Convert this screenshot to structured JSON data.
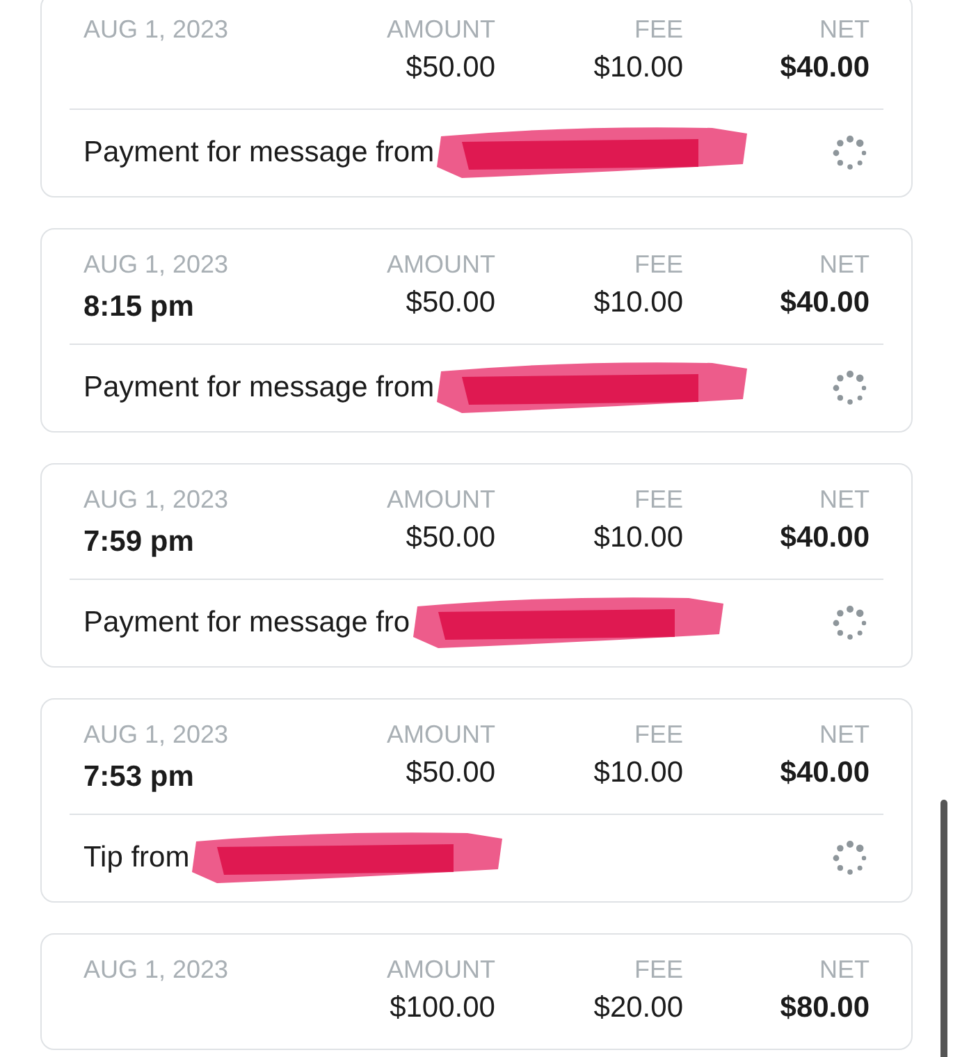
{
  "transactions": [
    {
      "date": "AUG 1, 2023",
      "amount_label": "AMOUNT",
      "amount": "$50.00",
      "fee_label": "FEE",
      "fee": "$10.00",
      "net_label": "NET",
      "net": "$40.00",
      "description": "Payment for message from",
      "redacted": true
    },
    {
      "date": "AUG 1, 2023",
      "time": "8:15 pm",
      "amount_label": "AMOUNT",
      "amount": "$50.00",
      "fee_label": "FEE",
      "fee": "$10.00",
      "net_label": "NET",
      "net": "$40.00",
      "description": "Payment for message from",
      "redacted": true
    },
    {
      "date": "AUG 1, 2023",
      "time": "7:59 pm",
      "amount_label": "AMOUNT",
      "amount": "$50.00",
      "fee_label": "FEE",
      "fee": "$10.00",
      "net_label": "NET",
      "net": "$40.00",
      "description": "Payment for message fro",
      "redacted": true
    },
    {
      "date": "AUG 1, 2023",
      "time": "7:53 pm",
      "amount_label": "AMOUNT",
      "amount": "$50.00",
      "fee_label": "FEE",
      "fee": "$10.00",
      "net_label": "NET",
      "net": "$40.00",
      "description": "Tip from",
      "redacted": true
    },
    {
      "date": "AUG 1, 2023",
      "amount_label": "AMOUNT",
      "amount": "$100.00",
      "fee_label": "FEE",
      "fee": "$20.00",
      "net_label": "NET",
      "net": "$80.00"
    }
  ]
}
